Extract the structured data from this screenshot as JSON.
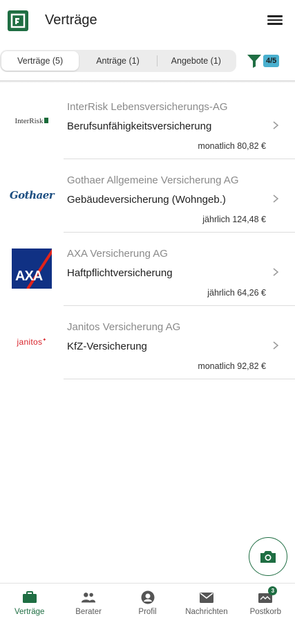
{
  "header": {
    "title": "Verträge"
  },
  "tabs": [
    {
      "label": "Verträge (5)",
      "active": true
    },
    {
      "label": "Anträge (1)",
      "active": false
    },
    {
      "label": "Angebote (1)",
      "active": false
    }
  ],
  "filter": {
    "badge": "4/5",
    "icon": "filter-icon",
    "color": "#1f6e43"
  },
  "contracts": [
    {
      "company": "InterRisk Lebensversicherungs-AG",
      "product": "Berufsunfähigkeitsversicherung",
      "price": "monatlich 80,82 €",
      "logo_text": "InterRisk"
    },
    {
      "company": "Gothaer Allgemeine Versicherung AG",
      "product": "Gebäudeversicherung (Wohngeb.)",
      "price": "jährlich 124,48 €",
      "logo_text": "Gothaer"
    },
    {
      "company": "AXA Versicherung AG",
      "product": "Haftpflichtversicherung",
      "price": "jährlich 64,26 €",
      "logo_text": "AXA"
    },
    {
      "company": "Janitos Versicherung AG",
      "product": "KfZ-Versicherung",
      "price": "monatlich 92,82 €",
      "logo_text": "janitos"
    }
  ],
  "fab": {
    "icon": "camera-icon"
  },
  "bottom_nav": [
    {
      "label": "Verträge",
      "icon": "briefcase-icon",
      "active": true
    },
    {
      "label": "Berater",
      "icon": "people-icon",
      "active": false
    },
    {
      "label": "Profil",
      "icon": "profile-icon",
      "active": false
    },
    {
      "label": "Nachrichten",
      "icon": "mail-icon",
      "active": false
    },
    {
      "label": "Postkorb",
      "icon": "inbox-icon",
      "active": false,
      "badge": "3"
    }
  ],
  "colors": {
    "brand": "#1f6e43",
    "filter_badge": "#4ab0cf",
    "axa_blue": "#103184",
    "axa_red": "#e2231a",
    "janitos_red": "#d8232a",
    "gothaer_blue": "#1d4f82"
  }
}
